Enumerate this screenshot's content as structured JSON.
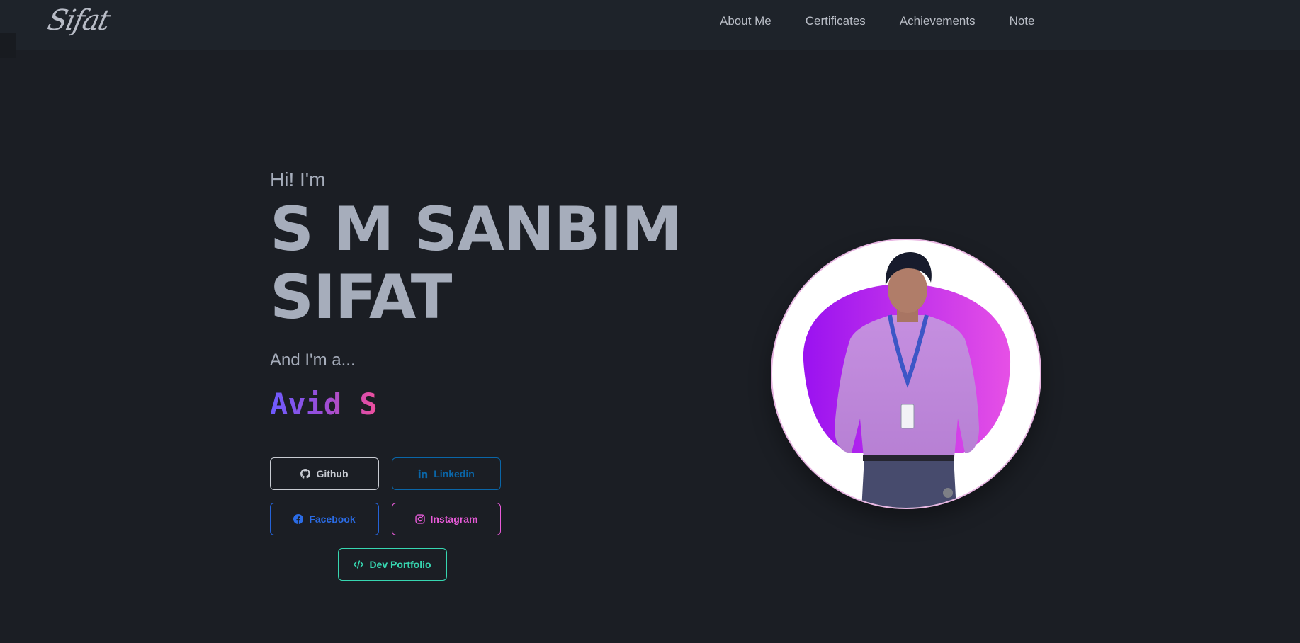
{
  "nav": {
    "logo": "Sifat",
    "links": [
      "About Me",
      "Certificates",
      "Achievements",
      "Note"
    ]
  },
  "hero": {
    "greeting": "Hi! I'm",
    "name_line1": "S M SANBIM",
    "name_line2": "SIFAT",
    "subtitle": "And I'm a...",
    "typed_text": "Avid S"
  },
  "buttons": {
    "github": "Github",
    "linkedin": "Linkedin",
    "facebook": "Facebook",
    "instagram": "Instagram",
    "dev_portfolio": "Dev Portfolio"
  },
  "colors": {
    "background": "#1b1e24",
    "navbar": "#1e232a",
    "text": "#a6adbb",
    "github": "#c8cbd2",
    "linkedin": "#0a66a8",
    "facebook": "#2563d8",
    "instagram": "#e85bd9",
    "dev_portfolio": "#37d7b1"
  }
}
